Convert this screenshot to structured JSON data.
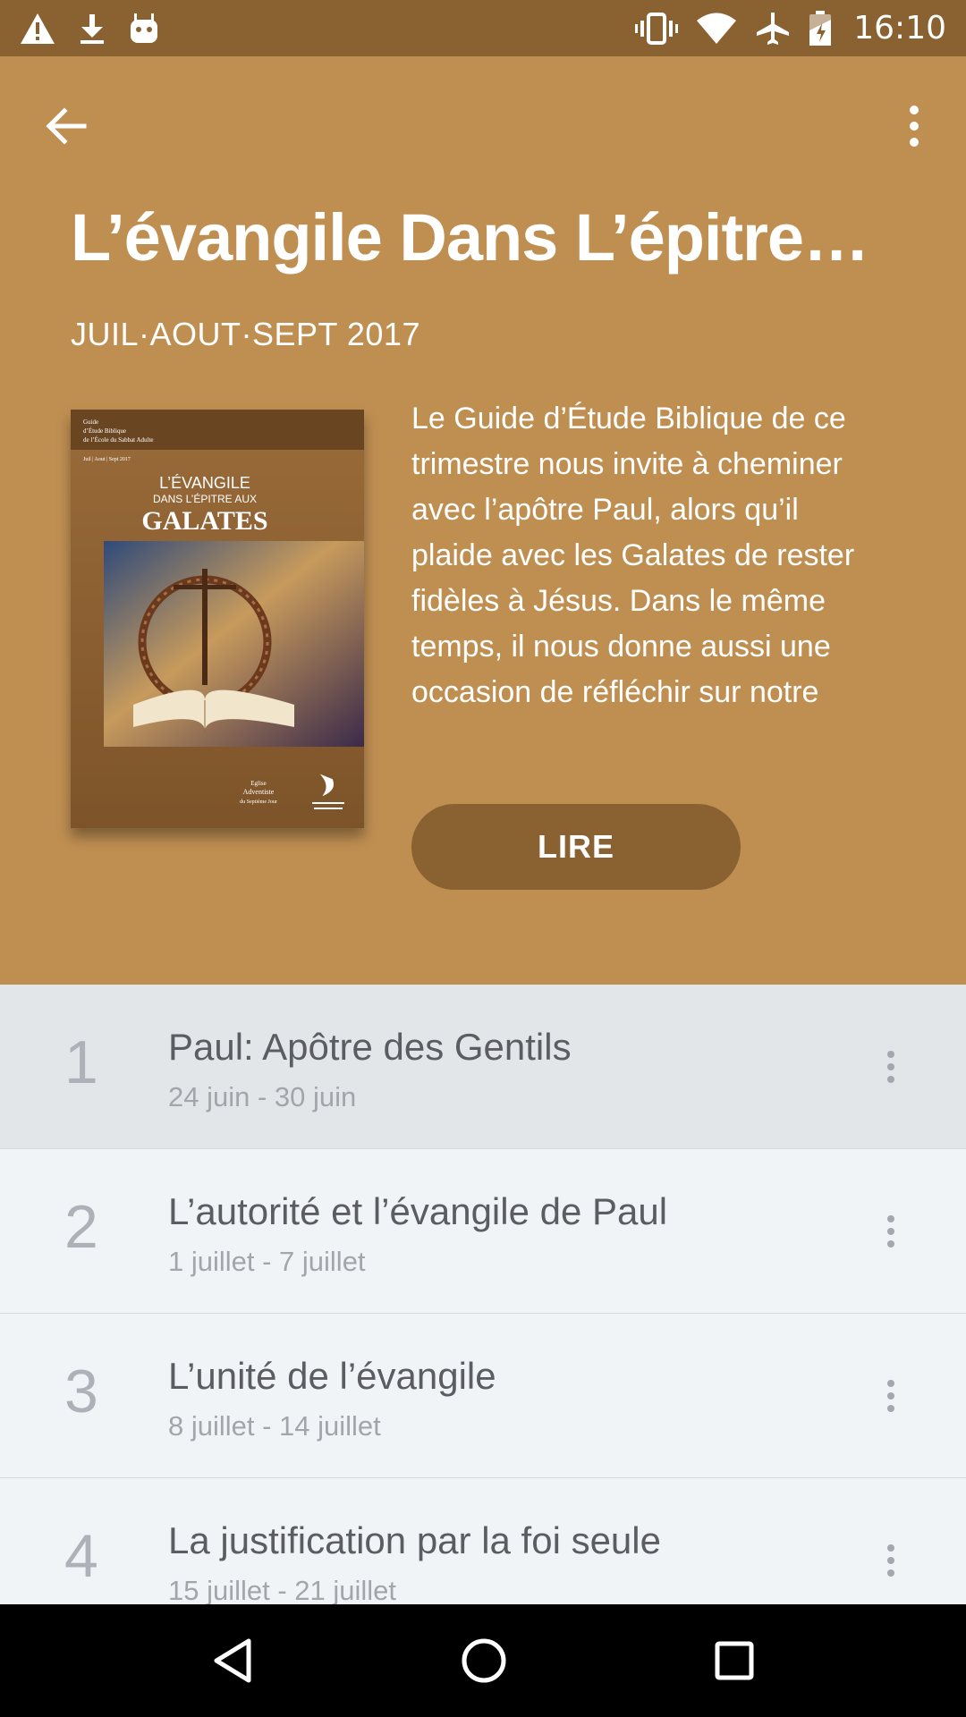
{
  "status_bar": {
    "time": "16:10",
    "left_icons": [
      "warning-icon",
      "download-icon",
      "android-icon"
    ],
    "right_icons": [
      "vibrate-icon",
      "wifi-icon",
      "airplane-icon",
      "battery-icon"
    ]
  },
  "header": {
    "title": "L’évangile Dans L’épitre…",
    "date_range": "JUIL·AOUT·SEPT 2017",
    "description": "Le Guide d’Étude Biblique de ce trimestre nous invite à cheminer avec l’apôtre Paul, alors qu’il plaide avec les Galates de rester fidèles à Jésus. Dans le même temps, il nous donne aussi une occasion de réfléchir sur notre propre c…",
    "read_label": "LIRE",
    "colors": {
      "background": "#bf8f52",
      "button": "#8a6131"
    }
  },
  "cover": {
    "guide_lines": [
      "Guide",
      "d’Étude Biblique",
      "de l’École du Sabbat Adulte",
      "Juil | Aout | Sept 2017"
    ],
    "title_line1": "L’ÉVANGILE",
    "title_line2": "DANS L’ÉPITRE AUX",
    "title_line3": "GALATES",
    "publisher_line1": "Eglise",
    "publisher_line2": "Adventiste",
    "publisher_line3": "du Septième Jour"
  },
  "lessons": [
    {
      "number": "1",
      "title": "Paul: Apôtre des Gentils",
      "dates": "24 juin - 30 juin"
    },
    {
      "number": "2",
      "title": "L’autorité et l’évangile de Paul",
      "dates": "1 juillet - 7 juillet"
    },
    {
      "number": "3",
      "title": "L’unité de l’évangile",
      "dates": "8 juillet - 14 juillet"
    },
    {
      "number": "4",
      "title": "La justification par la foi seule",
      "dates": "15 juillet - 21 juillet"
    }
  ],
  "nav_bar": {
    "icons": [
      "back-triangle-icon",
      "home-circle-icon",
      "recents-square-icon"
    ]
  }
}
